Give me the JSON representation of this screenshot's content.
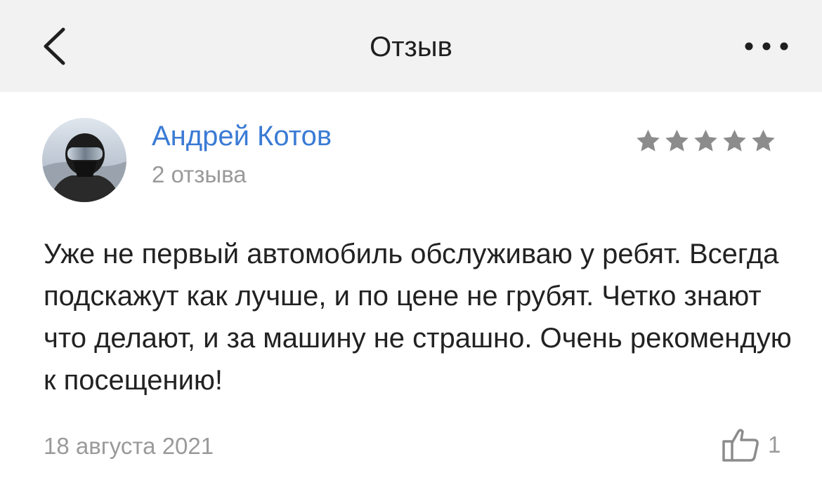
{
  "header": {
    "title": "Отзыв",
    "back_icon": "chevron-left-icon",
    "more_icon": "more-horizontal-icon"
  },
  "review": {
    "author": {
      "name": "Андрей Котов",
      "reviews_count": "2 отзыва",
      "avatar": "avatar-photo"
    },
    "rating": 5,
    "rating_max": 5,
    "text": "Уже не первый автомобиль обслуживаю у ребят. Всегда подскажут как лучше, и по цене не грубят. Четко знают что делают, и за машину не страшно. Очень рекомендую к посещению!",
    "date": "18 августа 2021",
    "likes": "1",
    "like_icon": "thumbs-up-icon"
  },
  "colors": {
    "header_bg": "#f2f2f2",
    "author_link": "#3a7bd5",
    "secondary_text": "#9a9a9a",
    "star": "#8c8c8c"
  }
}
